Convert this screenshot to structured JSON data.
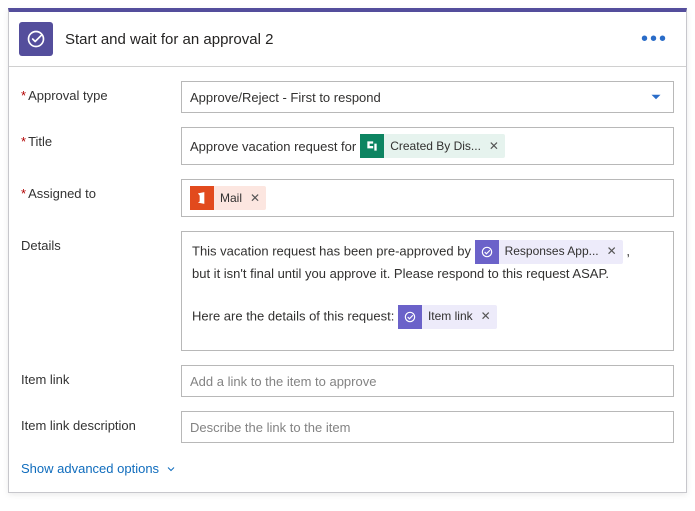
{
  "header": {
    "title": "Start and wait for an approval 2"
  },
  "fields": {
    "approval_type": {
      "label": "Approval type",
      "value": "Approve/Reject - First to respond",
      "required": true
    },
    "title": {
      "label": "Title",
      "prefix": "Approve vacation request for ",
      "token": "Created By Dis...",
      "required": true
    },
    "assigned_to": {
      "label": "Assigned to",
      "token": "Mail",
      "required": true
    },
    "details": {
      "label": "Details",
      "line1_before": "This vacation request has been pre-approved by ",
      "line1_token": "Responses App...",
      "line1_after": " ,",
      "line2": "but it isn't final until you approve it. Please respond to this request ASAP.",
      "line3_before": "Here are the details of this request: ",
      "line3_token": "Item link"
    },
    "item_link": {
      "label": "Item link",
      "placeholder": "Add a link to the item to approve"
    },
    "item_link_desc": {
      "label": "Item link description",
      "placeholder": "Describe the link to the item"
    }
  },
  "footer": {
    "advanced": "Show advanced options"
  }
}
